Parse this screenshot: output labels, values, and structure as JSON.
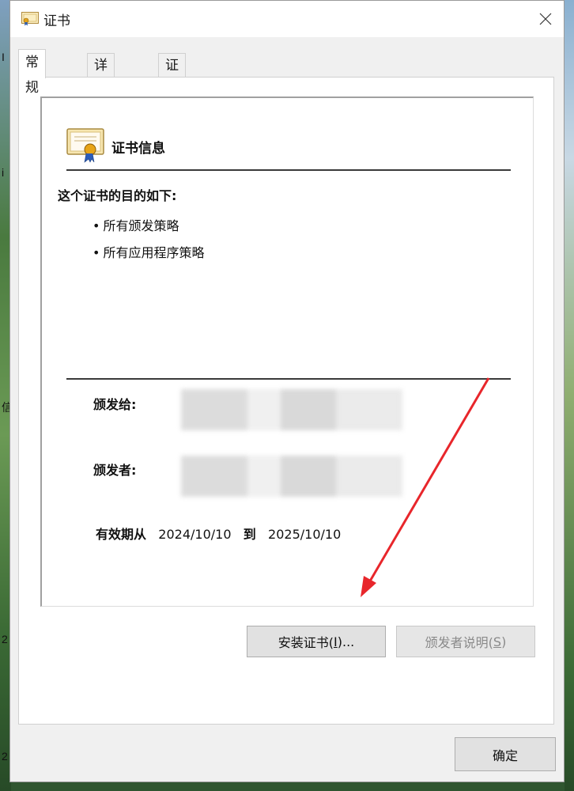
{
  "window": {
    "title": "证书"
  },
  "tabs": [
    {
      "label": "常规"
    },
    {
      "label": "详细信息"
    },
    {
      "label": "证书路径"
    }
  ],
  "general": {
    "section_title": "证书信息",
    "purpose_title": "这个证书的目的如下:",
    "purposes": [
      "所有颁发策略",
      "所有应用程序策略"
    ],
    "issued_to_label": "颁发给:",
    "issued_by_label": "颁发者:",
    "validity_label": "有效期从",
    "valid_from": "2024/10/10",
    "to_label": "到",
    "valid_to": "2025/10/10"
  },
  "buttons": {
    "install_label_prefix": "安装证书(",
    "install_hotkey": "I",
    "install_label_suffix": ")...",
    "issuer_stmt_prefix": "颁发者说明(",
    "issuer_stmt_hotkey": "S",
    "issuer_stmt_suffix": ")",
    "ok_label": "确定"
  },
  "desktop": {
    "left_glyphs": [
      "I",
      "i",
      "信",
      "2",
      "2"
    ]
  },
  "colors": {
    "annotation_arrow": "#e8262b",
    "window_bg": "#f0f0f0"
  },
  "icons": {
    "title": "certificate-icon",
    "close": "close-icon",
    "info": "certificate-ribbon-icon"
  }
}
